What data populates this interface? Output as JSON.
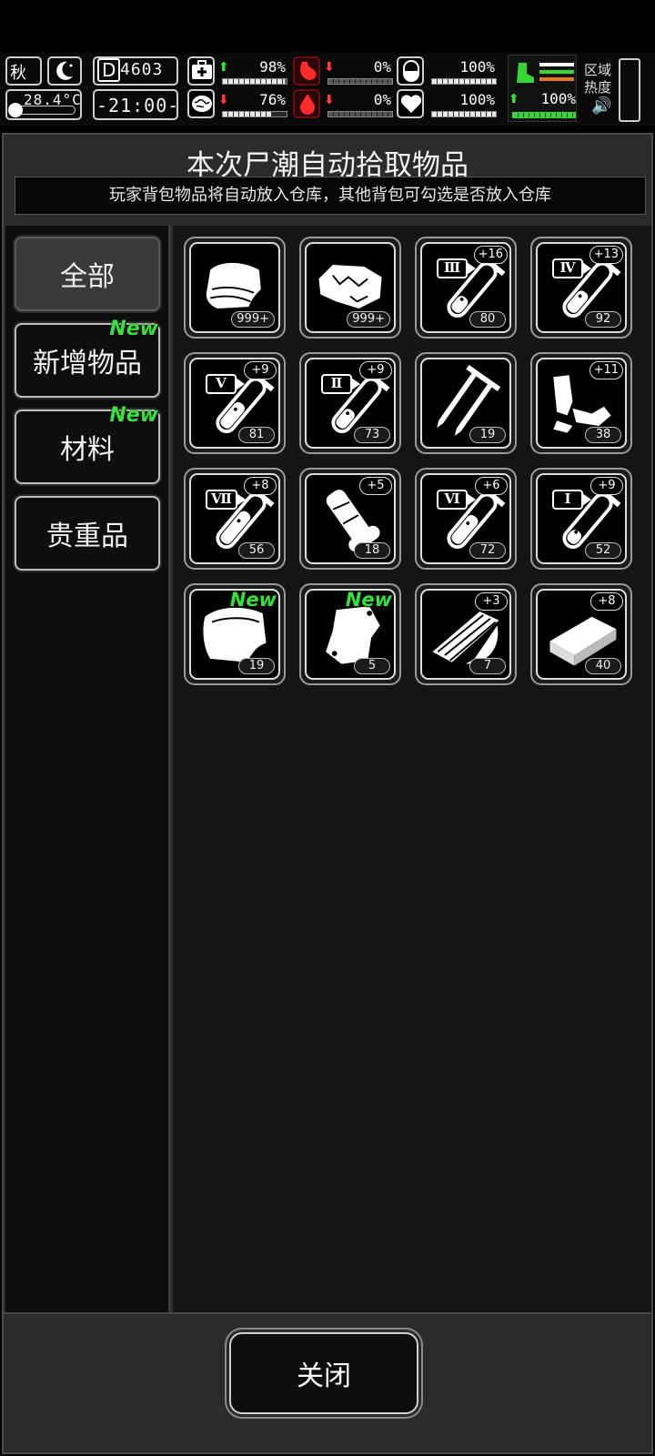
{
  "status": {
    "season": "秋",
    "temperature": "28.4°C",
    "day_counter": "4603",
    "day_prefix": "D",
    "clock": "-21:00-",
    "stats": [
      {
        "name": "health",
        "icon": "medkit-icon",
        "trend": "up",
        "value": "98%",
        "fill": 0.98
      },
      {
        "name": "hunger",
        "icon": "stomach-icon",
        "trend": "down",
        "value": "0%",
        "fill": 0.0
      },
      {
        "name": "pill",
        "icon": "pill-icon",
        "trend": "none",
        "value": "100%",
        "fill": 1.0
      },
      {
        "name": "sanity",
        "icon": "brain-icon",
        "trend": "down",
        "value": "76%",
        "fill": 0.76
      },
      {
        "name": "thirst",
        "icon": "blood-drop-icon",
        "trend": "down",
        "value": "0%",
        "fill": 0.0
      },
      {
        "name": "mood",
        "icon": "heart-icon",
        "trend": "none",
        "value": "100%",
        "fill": 1.0
      }
    ],
    "stamina": {
      "trend": "up",
      "value": "100%",
      "fill": 1.0
    },
    "zone_heat_label": "区域热度"
  },
  "panel": {
    "title": "本次尸潮自动拾取物品",
    "subtitle": "玩家背包物品将自动放入仓库，其他背包可勾选是否放入仓库"
  },
  "tabs": [
    {
      "label": "全部",
      "active": true,
      "new": false
    },
    {
      "label": "新增物品",
      "active": false,
      "new": true
    },
    {
      "label": "材料",
      "active": false,
      "new": true
    },
    {
      "label": "贵重品",
      "active": false,
      "new": false
    }
  ],
  "new_badge": "New",
  "items": [
    {
      "icon": "cloth-icon",
      "qty": "999+",
      "bonus": "",
      "tier": "",
      "new": false
    },
    {
      "icon": "meat-icon",
      "qty": "999+",
      "bonus": "",
      "tier": "",
      "new": false
    },
    {
      "icon": "test-tube-icon",
      "qty": "80",
      "bonus": "+16",
      "tier": "Ⅲ",
      "level": 0.25,
      "new": false
    },
    {
      "icon": "test-tube-icon",
      "qty": "92",
      "bonus": "+13",
      "tier": "Ⅳ",
      "level": 0.45,
      "new": false
    },
    {
      "icon": "test-tube-icon",
      "qty": "81",
      "bonus": "+9",
      "tier": "Ⅴ",
      "level": 0.6,
      "new": false
    },
    {
      "icon": "test-tube-icon",
      "qty": "73",
      "bonus": "+9",
      "tier": "Ⅱ",
      "level": 0.35,
      "new": false
    },
    {
      "icon": "nails-icon",
      "qty": "19",
      "bonus": "",
      "tier": "",
      "new": false
    },
    {
      "icon": "scrap-metal-icon",
      "qty": "38",
      "bonus": "+11",
      "tier": "",
      "new": false
    },
    {
      "icon": "test-tube-icon",
      "qty": "56",
      "bonus": "+8",
      "tier": "Ⅶ",
      "level": 0.85,
      "new": false
    },
    {
      "icon": "bone-icon",
      "qty": "18",
      "bonus": "+5",
      "tier": "",
      "new": false
    },
    {
      "icon": "test-tube-icon",
      "qty": "72",
      "bonus": "+6",
      "tier": "Ⅵ",
      "level": 0.7,
      "new": false
    },
    {
      "icon": "test-tube-icon",
      "qty": "52",
      "bonus": "+9",
      "tier": "Ⅰ",
      "level": 0.15,
      "new": false
    },
    {
      "icon": "leather-icon",
      "qty": "19",
      "bonus": "",
      "tier": "",
      "new": true
    },
    {
      "icon": "bag-icon",
      "qty": "5",
      "bonus": "",
      "tier": "",
      "new": true
    },
    {
      "icon": "wood-planks-icon",
      "qty": "7",
      "bonus": "+3",
      "tier": "",
      "new": false
    },
    {
      "icon": "brick-icon",
      "qty": "40",
      "bonus": "+8",
      "tier": "",
      "new": false
    }
  ],
  "footer": {
    "close_label": "关闭"
  }
}
